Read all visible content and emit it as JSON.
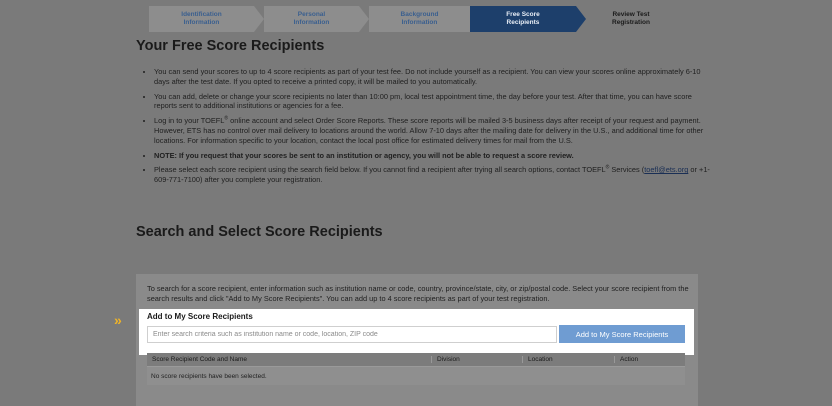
{
  "steps": [
    {
      "line1": "Identification",
      "line2": "Information"
    },
    {
      "line1": "Personal",
      "line2": "Information"
    },
    {
      "line1": "Background",
      "line2": "Information"
    },
    {
      "line1": "Free Score",
      "line2": "Recipients"
    },
    {
      "line1": "Review Test",
      "line2": "Registration"
    }
  ],
  "title": "Your Free Score Recipients",
  "bullets": {
    "b1": "You can send your scores to up to 4 score recipients as part of your test fee. Do not include yourself as a recipient. You can view your scores online approximately 6-10 days after the test date. If you opted to receive a printed copy, it will be mailed to you automatically.",
    "b2": "You can add, delete or change your score recipients no later than 10:00 pm, local test appointment time, the day before your test. After that time, you can have score reports sent to additional institutions or agencies for a fee.",
    "b3_pre": "Log in to your TOEFL",
    "b3_sup": "®",
    "b3_post": " online account and select Order Score Reports. These score reports will be mailed 3-5 business days after receipt of your request and payment. However, ETS has no control over mail delivery to locations around the world. Allow 7-10 days after the mailing date for delivery in the U.S., and additional time for other locations. For information specific to your location, contact the local post office for estimated delivery times for mail from the U.S.",
    "b4": "NOTE: If you request that your scores be sent to an institution or agency, you will not be able to request a score review.",
    "b5_pre": "Please select each score recipient using the search field below. If you cannot find a recipient after trying all search options, contact TOEFL",
    "b5_sup": "®",
    "b5_mid": " Services (",
    "b5_link": "toefl@ets.org",
    "b5_post": " or +1-609-771-7100) after you complete your registration."
  },
  "section_title": "Search and Select Score Recipients",
  "panel_text": "To search for a score recipient, enter information such as institution name or code, country, province/state, city, or zip/postal code. Select your score recipient from the search results and click \"Add to My Score Recipients\". You can add up to 4 score recipients as part of your test registration.",
  "add_label": "Add to My Score Recipients",
  "search_placeholder": "Enter search criteria such as institution name or code, location, ZIP code",
  "add_button": "Add to My Score Recipients",
  "table": {
    "headers": [
      "Score Recipient Code and Name",
      "Division",
      "Location",
      "Action"
    ],
    "empty": "No score recipients have been selected."
  },
  "colors": {
    "active_step": "#1d3f6b",
    "button": "#6f9cd2",
    "chevron": "#f0b428"
  },
  "icons": {
    "pointer": "double-chevron-right-icon"
  }
}
